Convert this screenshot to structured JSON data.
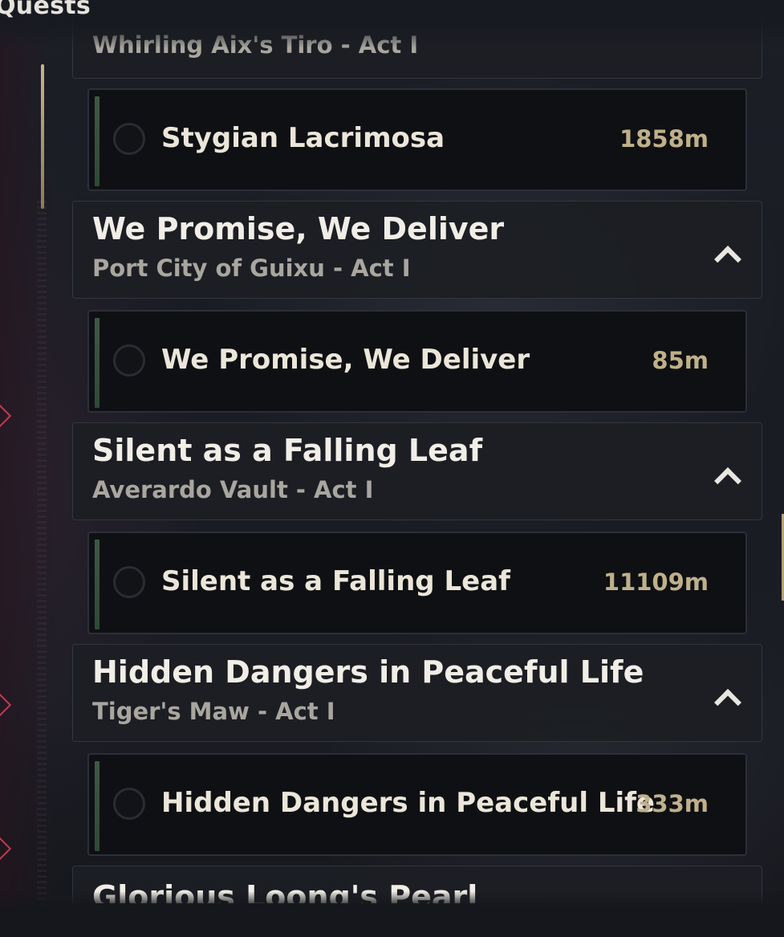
{
  "window": {
    "title": "Quests"
  },
  "groups": [
    {
      "title": "",
      "subtitle": "Whirling Aix's Tiro - Act I",
      "quests": [
        {
          "name": "Stygian Lacrimosa",
          "distance": "1858m"
        }
      ]
    },
    {
      "title": "We Promise, We Deliver",
      "subtitle": "Port City of Guixu - Act I",
      "quests": [
        {
          "name": "We Promise, We Deliver",
          "distance": "85m"
        }
      ]
    },
    {
      "title": "Silent as a Falling Leaf",
      "subtitle": "Averardo Vault - Act I",
      "quests": [
        {
          "name": "Silent as a Falling Leaf",
          "distance": "11109m"
        }
      ]
    },
    {
      "title": "Hidden Dangers in Peaceful Life",
      "subtitle": "Tiger's Maw - Act I",
      "quests": [
        {
          "name": "Hidden Dangers in Peaceful Life",
          "distance": "333m"
        }
      ]
    },
    {
      "title": "Glorious Loong's Pearl",
      "subtitle": "",
      "quests": []
    }
  ],
  "colors": {
    "accent_gold": "#bfb08a",
    "tracker_green": "#3d5a45",
    "marker_red": "#c33a55"
  },
  "icons": {
    "collapse": "chevron-up-icon",
    "status": "circle-icon",
    "map_marker": "diamond-icon"
  }
}
